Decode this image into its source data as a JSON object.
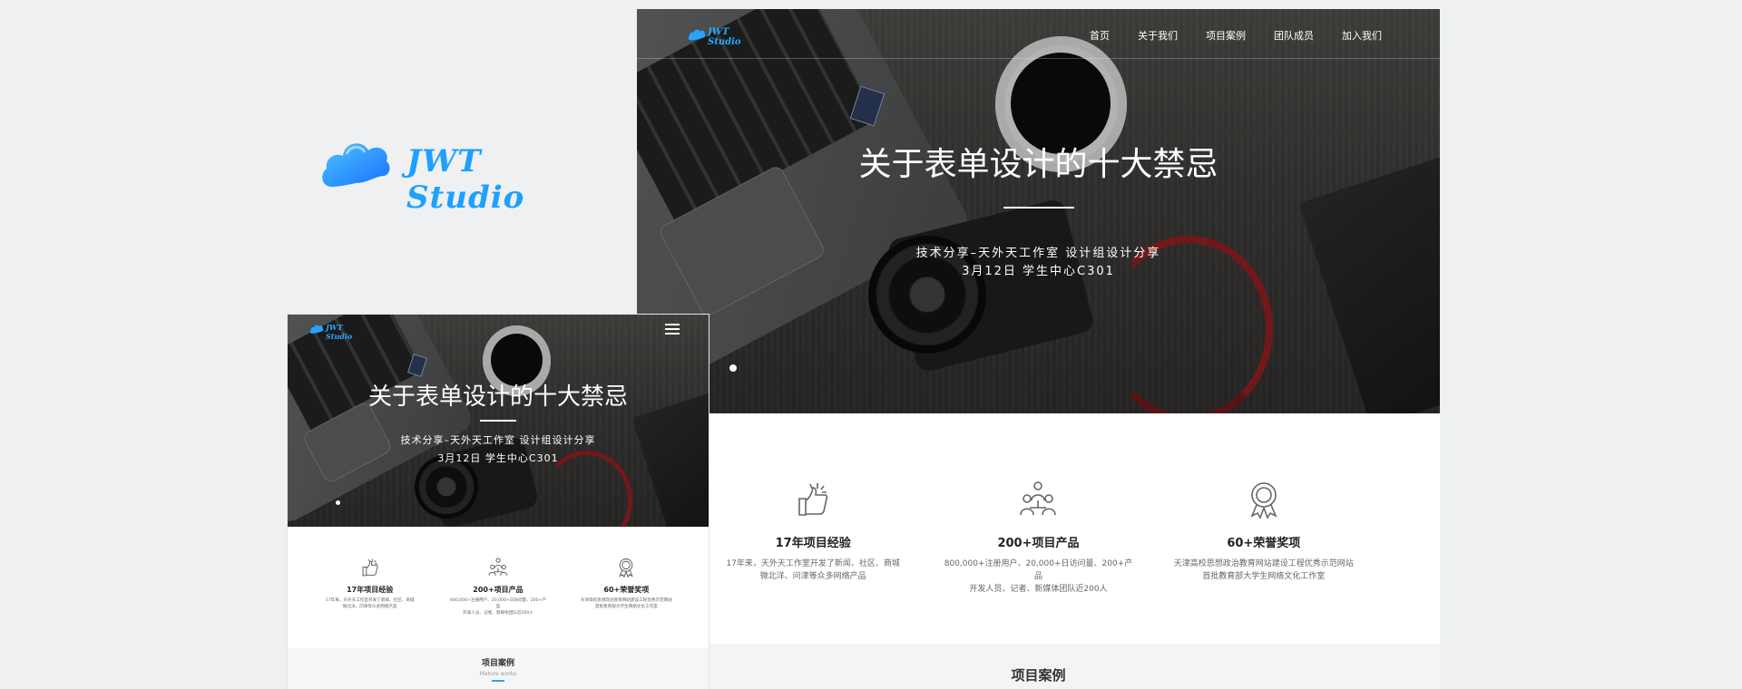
{
  "brand": {
    "name": "JWT Studio",
    "color": "#1fa0ff",
    "icon": "cloud-icon"
  },
  "desktop": {
    "logo_text": "JWT Studio",
    "nav": [
      "首页",
      "关于我们",
      "项目案例",
      "团队成员",
      "加入我们"
    ],
    "hero": {
      "title": "关于表单设计的十大禁忌",
      "subtitle_line1": "技术分享–天外天工作室 设计组设计分享",
      "subtitle_line2": "3月12日 学生中心C301"
    },
    "stats": [
      {
        "icon": "thumbs-up-icon",
        "title": "17年项目经验",
        "desc_line1": "17年来，天外天工作室开发了新闻、社区、商城",
        "desc_line2": "微北洋、问津等众多网络产品"
      },
      {
        "icon": "team-icon",
        "title": "200+项目产品",
        "desc_line1": "800,000+注册用户、20,000+日访问量、200+产品",
        "desc_line2": "开发人员、记者、新媒体团队近200人"
      },
      {
        "icon": "award-medal-icon",
        "title": "60+荣誉奖项",
        "desc_line1": "天津高校思想政治教育网站建设工程优秀示范网站",
        "desc_line2": "首批教育部大学生网络文化工作室"
      }
    ],
    "section_title": "项目案例"
  },
  "mobile": {
    "logo_text": "JWT Studio",
    "menu_icon": "hamburger-menu-icon",
    "hero": {
      "title": "关于表单设计的十大禁忌",
      "subtitle_line1": "技术分享–天外天工作室 设计组设计分享",
      "subtitle_line2": "3月12日 学生中心C301"
    },
    "stats": [
      {
        "icon": "thumbs-up-icon",
        "title": "17年项目经验",
        "desc_line1": "17年来，天外天工作室开发了新闻、社区、商城",
        "desc_line2": "微北洋、问津等众多网络产品"
      },
      {
        "icon": "team-icon",
        "title": "200+项目产品",
        "desc_line1": "800,000+注册用户、20,000+日访问量、200+产品",
        "desc_line2": "开发人员、记者、新媒体团队近200人"
      },
      {
        "icon": "award-medal-icon",
        "title": "60+荣誉奖项",
        "desc_line1": "天津高校思想政治教育网站建设工程优秀示范网站",
        "desc_line2": "首批教育部大学生网络文化工作室"
      }
    ],
    "section_title": "项目案例",
    "section_subtitle": "Mature works",
    "accent": "#2aa3ff"
  }
}
